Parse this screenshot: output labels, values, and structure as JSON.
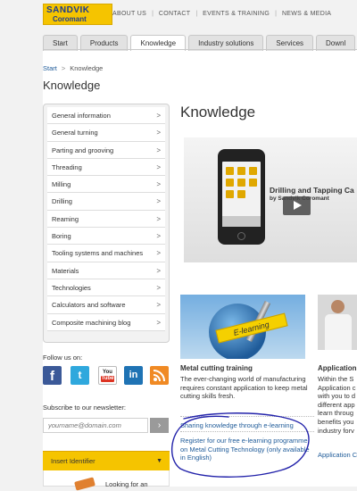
{
  "brand": {
    "line1": "SANDVIK",
    "line2": "Coromant"
  },
  "top_links": [
    "ABOUT US",
    "CONTACT",
    "EVENTS & TRAINING",
    "NEWS & MEDIA"
  ],
  "tabs": [
    {
      "label": "Start",
      "active": false
    },
    {
      "label": "Products",
      "active": false
    },
    {
      "label": "Knowledge",
      "active": true
    },
    {
      "label": "Industry solutions",
      "active": false
    },
    {
      "label": "Services",
      "active": false
    },
    {
      "label": "Downl",
      "active": false
    }
  ],
  "breadcrumb": {
    "home": "Start",
    "separator": ">",
    "current": "Knowledge"
  },
  "page_title": "Knowledge",
  "main_title": "Knowledge",
  "sidebar": {
    "arrow_glyph": ">",
    "items": [
      "General information",
      "General turning",
      "Parting and grooving",
      "Threading",
      "Milling",
      "Drilling",
      "Reaming",
      "Boring",
      "Tooling systems and machines",
      "Materials",
      "Technologies",
      "Calculators and software",
      "Composite machining blog"
    ]
  },
  "follow": {
    "label": "Follow us on:",
    "icons": [
      "facebook-icon",
      "twitter-icon",
      "youtube-icon",
      "linkedin-icon",
      "rss-icon"
    ],
    "fb_glyph": "f",
    "tw_glyph": "t",
    "yt_top": "You",
    "yt_bottom": "Tube",
    "li_glyph": "in"
  },
  "newsletter": {
    "label": "Subscribe to our newsletter:",
    "placeholder": "yourname@domain.com",
    "go_glyph": "›"
  },
  "identifier": {
    "label": "Insert Identifier",
    "caret": "▼",
    "body_text": "Looking for an"
  },
  "hero": {
    "title": "Drilling and Tapping Ca",
    "subtitle": "by Sandvik Coromant"
  },
  "card1": {
    "banner": "E-learning",
    "title": "Metal cutting training",
    "description": "The ever-changing world of manufacturing requires constant application to keep metal cutting skills fresh.",
    "link1": "Sharing knowledge through e-learning",
    "link2": "Register for our free e-learning programme on Metal Cutting Technology (only available in English)"
  },
  "card2": {
    "title": "Application",
    "lines": [
      "Within the S",
      "Application c",
      "with you to d",
      "different app",
      "learn throug",
      "benefits you",
      "industry forv"
    ],
    "link": "Application C"
  },
  "colors": {
    "brand_yellow": "#f5c400",
    "brand_blue": "#1d3c8f",
    "link_blue": "#1f5b99",
    "annotation_ink": "#2222aa"
  }
}
